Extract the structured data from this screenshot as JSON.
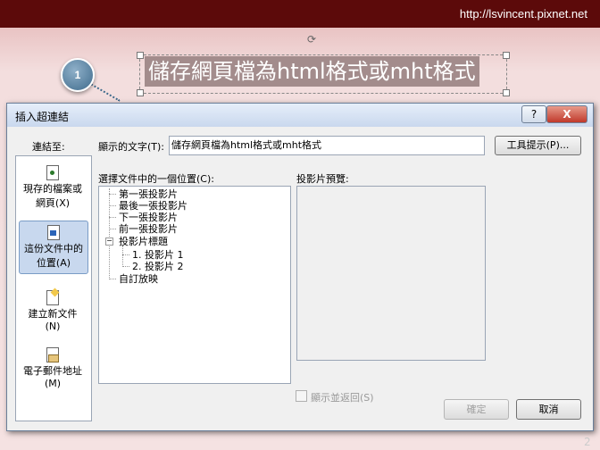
{
  "slide": {
    "url": "http://lsvincent.pixnet.net",
    "title": "儲存網頁檔為html格式或mht格式",
    "badge": "1"
  },
  "dialog": {
    "title": "插入超連結",
    "help": "?",
    "close": "X",
    "link_to_label": "連結至:",
    "display_text_label": "顯示的文字(T):",
    "display_text_value": "儲存網頁檔為html格式或mht格式",
    "screentip_button": "工具提示(P)...",
    "place_label": "選擇文件中的一個位置(C):",
    "preview_label": "投影片預覽:",
    "show_return_label": "顯示並返回(S)",
    "ok_button": "確定",
    "cancel_button": "取消",
    "link_items": [
      {
        "line1": "現存的檔案或",
        "line2": "網頁(X)",
        "icon": "web-page-icon"
      },
      {
        "line1": "這份文件中的",
        "line2": "位置(A)",
        "icon": "document-place-icon"
      },
      {
        "line1": "建立新文件",
        "line2": "(N)",
        "icon": "new-document-icon"
      },
      {
        "line1": "電子郵件地址",
        "line2": "(M)",
        "icon": "email-icon"
      }
    ],
    "tree": {
      "first": "第一張投影片",
      "last": "最後一張投影片",
      "next": "下一張投影片",
      "prev": "前一張投影片",
      "titles": "投影片標題",
      "collapse": "−",
      "slide1": "1. 投影片 1",
      "slide2": "2. 投影片 2",
      "custom": "自訂放映"
    }
  },
  "page_number": "2"
}
